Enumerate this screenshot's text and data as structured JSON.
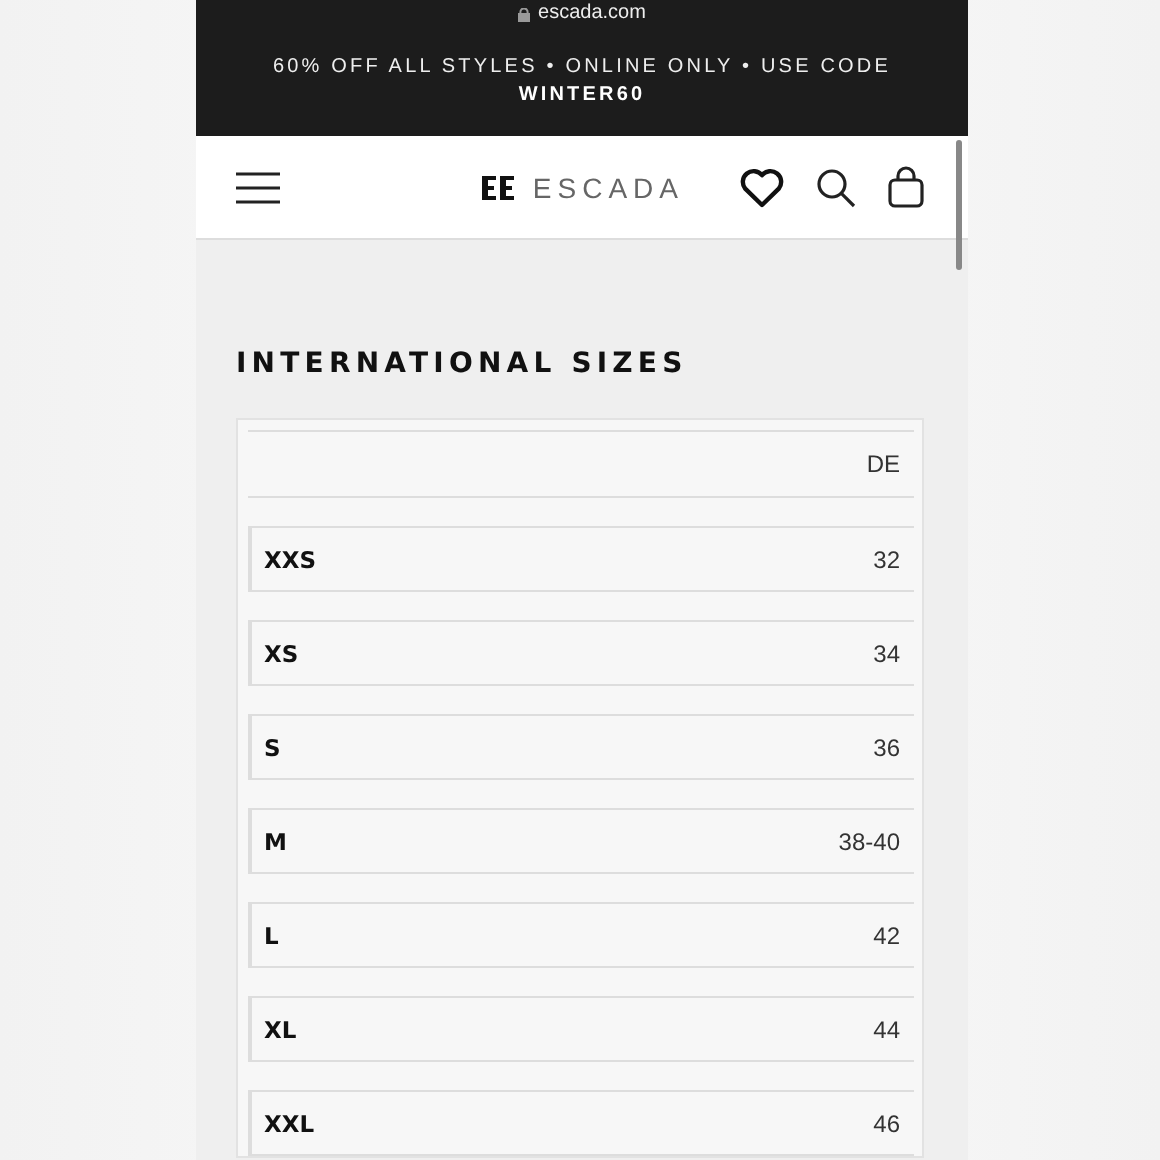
{
  "browser": {
    "url": "escada.com"
  },
  "promo_banner": {
    "text": "60% OFF ALL STYLES • ONLINE ONLY • USE CODE",
    "code": "WINTER60"
  },
  "header": {
    "logo_text": "ESCADA"
  },
  "section_title": "INTERNATIONAL SIZES",
  "size_table": {
    "column_header": "DE",
    "rows": [
      {
        "size": "XXS",
        "de": "32"
      },
      {
        "size": "XS",
        "de": "34"
      },
      {
        "size": "S",
        "de": "36"
      },
      {
        "size": "M",
        "de": "38-40"
      },
      {
        "size": "L",
        "de": "42"
      },
      {
        "size": "XL",
        "de": "44"
      },
      {
        "size": "XXL",
        "de": "46"
      }
    ]
  }
}
